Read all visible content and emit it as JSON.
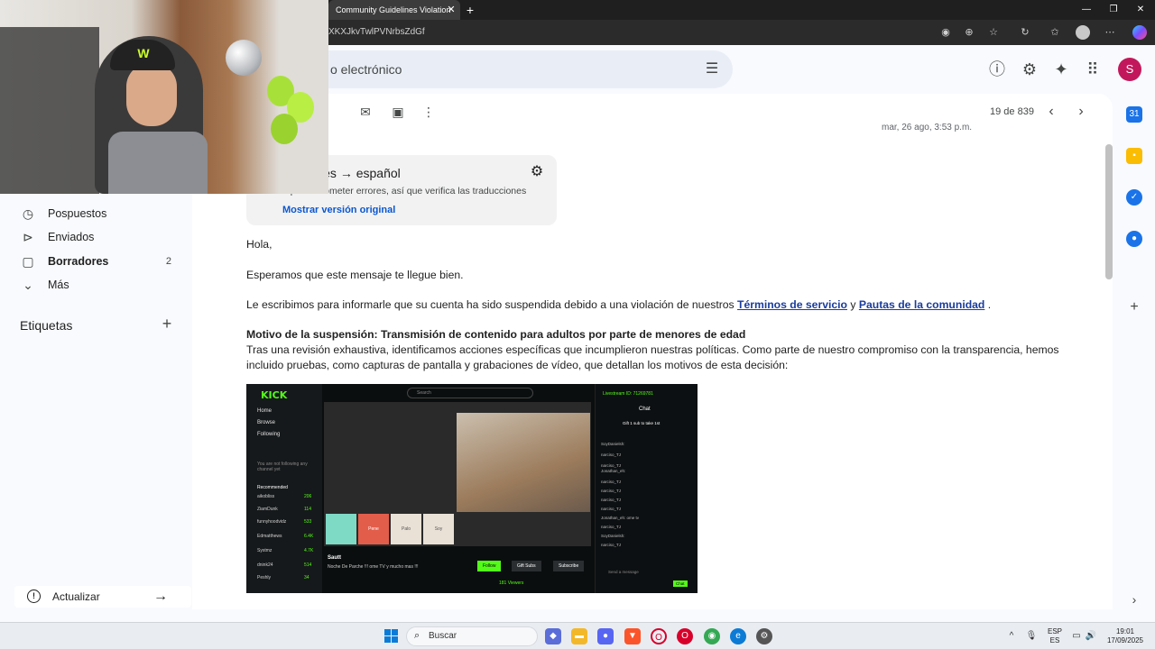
{
  "browser": {
    "tab_title": "Community Guidelines Violation",
    "tab_close": "✕",
    "new_tab": "+",
    "url": "XKXJkvTwlPVNrbsZdGf",
    "window": {
      "minimize": "—",
      "maximize": "❐",
      "close": "✕"
    }
  },
  "header": {
    "search_placeholder": "o electrónico",
    "avatar_letter": "S"
  },
  "toolbar": {
    "pager": "19 de 839",
    "date_peek": "mar, 26 ago, 3:53 p.m."
  },
  "sidebar": {
    "items": [
      {
        "label": "Pospuestos",
        "count": "",
        "icon": "clock-icon"
      },
      {
        "label": "Enviados",
        "count": "",
        "icon": "send-icon"
      },
      {
        "label": "Borradores",
        "count": "2",
        "icon": "draft-icon"
      },
      {
        "label": "Más",
        "count": "",
        "icon": "chevron-down-icon"
      }
    ],
    "labels_title": "Etiquetas",
    "update_label": "Actualizar"
  },
  "translation": {
    "title": "do: inglés → español",
    "note": "...puede cometer errores, así que verifica las traducciones",
    "link": "Mostrar versión original"
  },
  "email": {
    "greeting": "Hola,",
    "line1": "Esperamos que este mensaje te llegue bien.",
    "line2_pre": "Le escribimos para informarle que su cuenta ha sido suspendida debido a una violación de nuestros ",
    "terms_link": "Términos de servicio",
    "line2_mid": " y ",
    "guidelines_link": "Pautas de la comunidad",
    "line2_post": " .",
    "reason_title": "Motivo de la suspensión: Transmisión de contenido para adultos por parte de menores de edad",
    "reason_body": "Tras una revisión exhaustiva, identificamos acciones específicas que incumplieron nuestras políticas. Como parte de nuestro compromiso con la transparencia, hemos incluido pruebas, como capturas de pantalla y grabaciones de vídeo, que detallan los motivos de esta decisión:"
  },
  "kick": {
    "logo": "KICK",
    "search": "Search",
    "nav": [
      "Home",
      "Browse",
      "Following"
    ],
    "following_note": "You are not following any channel yet",
    "recommended_title": "Recommended",
    "recommended": [
      {
        "name": "aikobliss",
        "count": "206"
      },
      {
        "name": "ZiamDunk",
        "count": "114"
      },
      {
        "name": "funnyhoodvidz",
        "count": "533"
      },
      {
        "name": "Edmatthews",
        "count": "6.4K"
      },
      {
        "name": "Systmz",
        "count": "4.7K"
      },
      {
        "name": "dnink24",
        "count": "514"
      },
      {
        "name": "Peshly",
        "count": "34"
      }
    ],
    "tiles": [
      "Pene",
      "Palo",
      "Soy"
    ],
    "streamer": "Sautt",
    "stream_title": "Noche De Parche !!! ome TV y mucho mas !!!",
    "follow": "Follow",
    "gift_subs": "Gift Subs",
    "subscribe": "Subscribe",
    "viewers": "181 Viewers",
    "livestream_id": "Livestream ID: 71269781",
    "chat_title": "Chat",
    "gift_banner": "Gift 1 sub to take 1st",
    "chat_lines": [
      "SoyDanielsh:",
      "narciso_TJ",
      "narciso_TJ",
      "Jonathan_eh:",
      "narciso_TJ",
      "narciso_TJ",
      "narciso_TJ",
      "narciso_TJ",
      "Jonathan_eh: ome tv",
      "narciso_TJ",
      "SoyDanielsh:",
      "narciso_TJ"
    ],
    "send_placeholder": "Send a message",
    "chat_button": "Chat"
  },
  "taskbar": {
    "search": "Buscar",
    "lang_top": "ESP",
    "lang_bottom": "ES",
    "time": "19:01",
    "date": "17/09/2025"
  }
}
